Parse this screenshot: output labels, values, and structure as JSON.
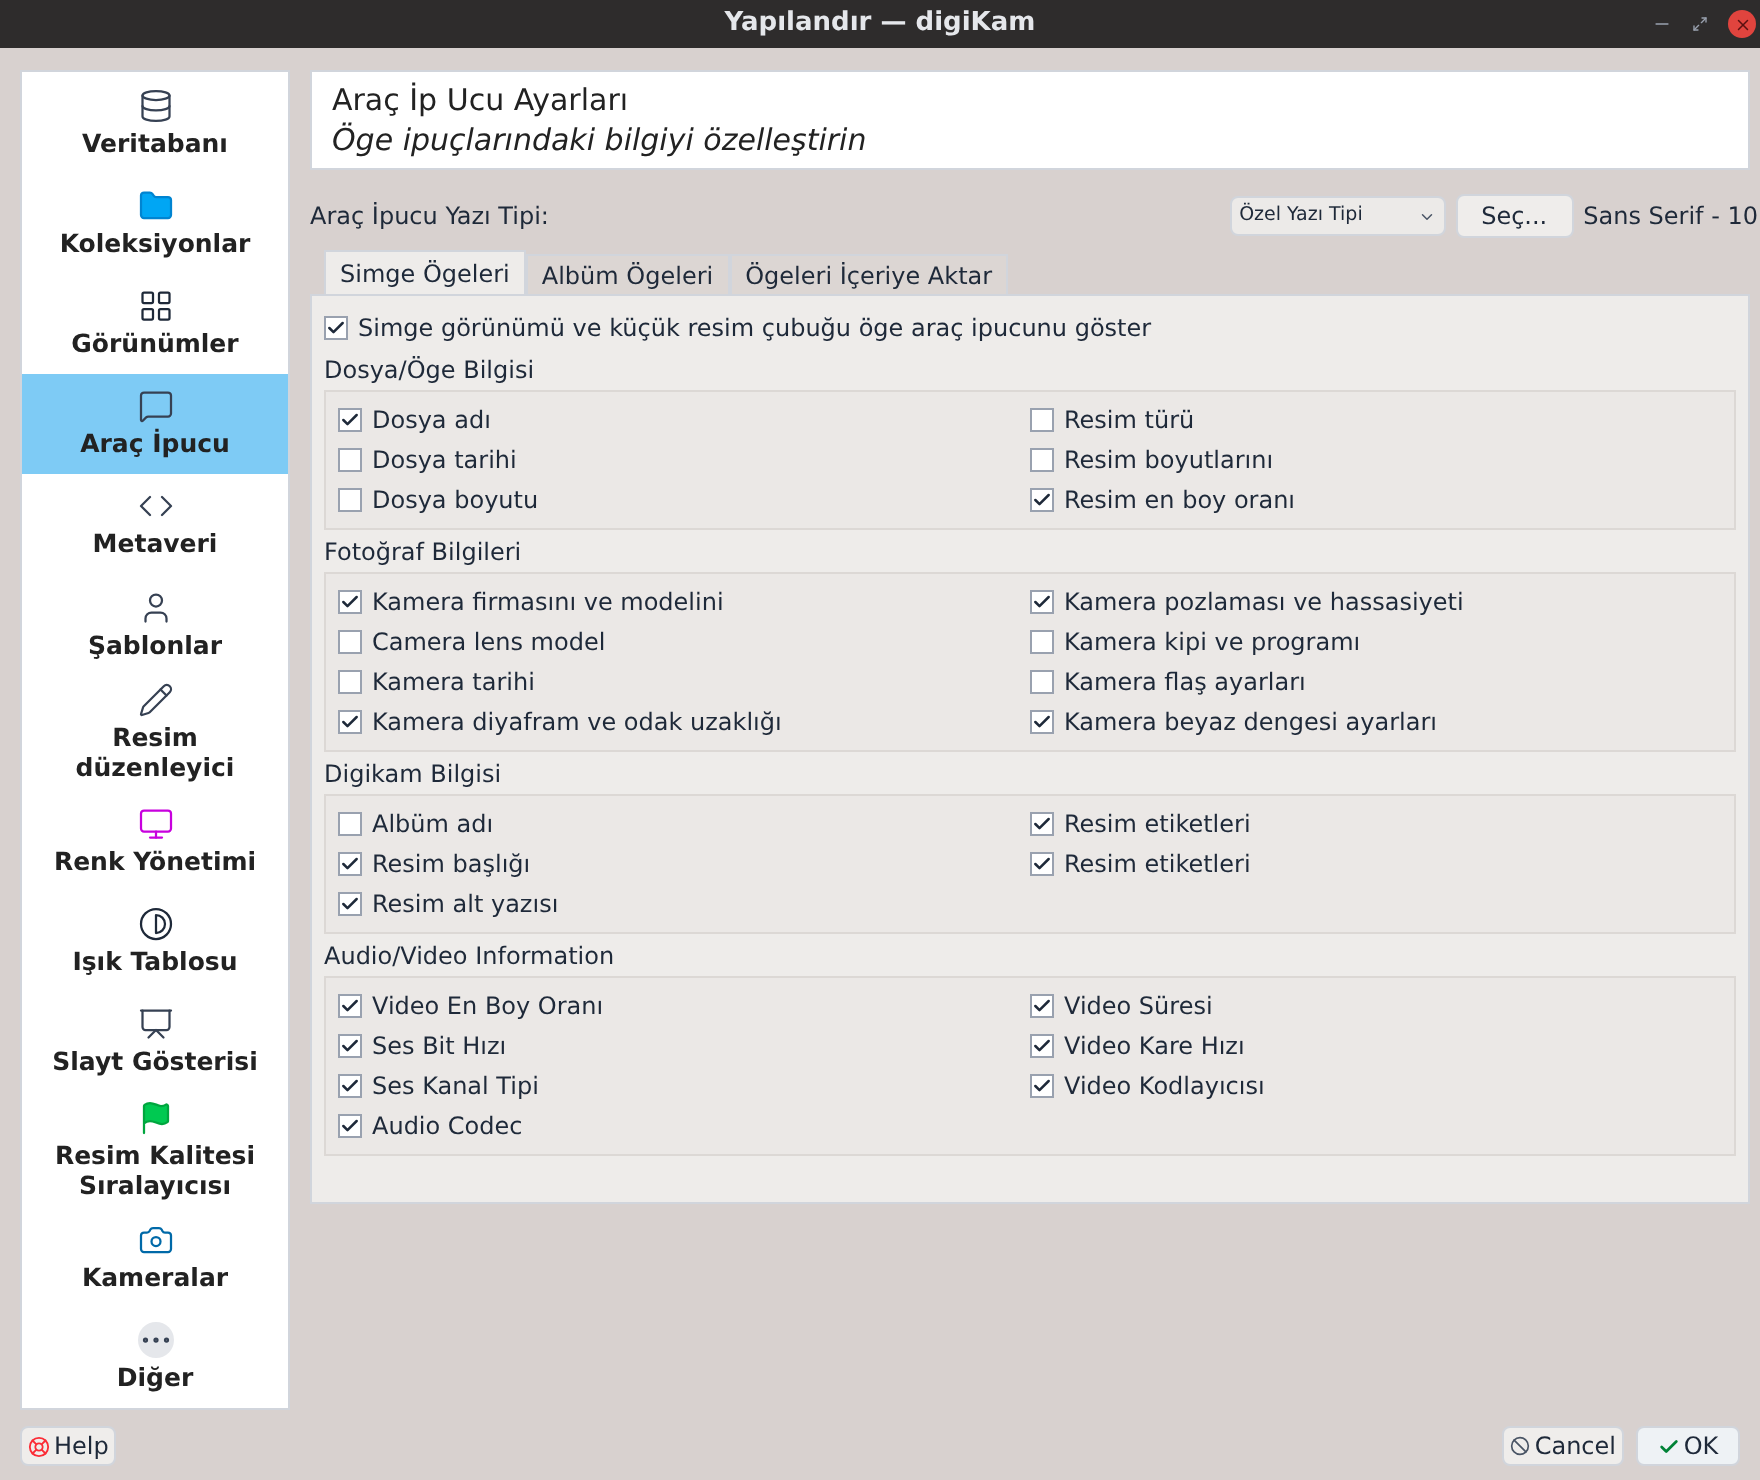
{
  "window": {
    "title": "Yapılandır — digiKam"
  },
  "sidebar": {
    "items": [
      {
        "label": "Veritabanı",
        "selected": false
      },
      {
        "label": "Koleksiyonlar",
        "selected": false
      },
      {
        "label": "Görünümler",
        "selected": false
      },
      {
        "label": "Araç İpucu",
        "selected": true
      },
      {
        "label": "Metaveri",
        "selected": false
      },
      {
        "label": "Şablonlar",
        "selected": false
      },
      {
        "label": "Resim düzenleyici",
        "selected": false
      },
      {
        "label": "Renk Yönetimi",
        "selected": false
      },
      {
        "label": "Işık Tablosu",
        "selected": false
      },
      {
        "label": "Slayt Gösterisi",
        "selected": false
      },
      {
        "label": "Resim Kalitesi Sıralayıcısı",
        "selected": false
      },
      {
        "label": "Kameralar",
        "selected": false
      },
      {
        "label": "Diğer",
        "selected": false
      }
    ]
  },
  "header": {
    "title": "Araç İp Ucu Ayarları",
    "subtitle": "Öge ipuçlarındaki bilgiyi özelleştirin"
  },
  "font_row": {
    "label": "Araç İpucu Yazı Tipi:",
    "dropdown": "Özel Yazı Tipi",
    "button": "Seç...",
    "font": "Sans Serif - 10"
  },
  "tabs": [
    {
      "label": "Simge Ögeleri",
      "selected": true
    },
    {
      "label": "Albüm Ögeleri",
      "selected": false
    },
    {
      "label": "Ögeleri İçeriye Aktar",
      "selected": false
    }
  ],
  "show_tooltip": {
    "label": "Simge görünümü ve küçük resim çubuğu öge araç ipucunu göster",
    "checked": true
  },
  "groups": [
    {
      "title": "Dosya/Öge Bilgisi",
      "columns": [
        [
          {
            "label": "Dosya adı",
            "checked": true
          },
          {
            "label": "Dosya tarihi",
            "checked": false
          },
          {
            "label": "Dosya boyutu",
            "checked": false
          }
        ],
        [
          {
            "label": "Resim türü",
            "checked": false
          },
          {
            "label": "Resim boyutlarını",
            "checked": false
          },
          {
            "label": "Resim en boy oranı",
            "checked": true
          }
        ]
      ]
    },
    {
      "title": "Fotoğraf Bilgileri",
      "columns": [
        [
          {
            "label": "Kamera firmasını ve modelini",
            "checked": true
          },
          {
            "label": "Camera lens model",
            "checked": false
          },
          {
            "label": "Kamera tarihi",
            "checked": false
          },
          {
            "label": "Kamera diyafram ve odak uzaklığı",
            "checked": true
          }
        ],
        [
          {
            "label": "Kamera pozlaması ve hassasiyeti",
            "checked": true
          },
          {
            "label": "Kamera kipi ve programı",
            "checked": false
          },
          {
            "label": "Kamera flaş ayarları",
            "checked": false
          },
          {
            "label": "Kamera beyaz dengesi ayarları",
            "checked": true
          }
        ]
      ]
    },
    {
      "title": "Digikam Bilgisi",
      "columns": [
        [
          {
            "label": "Albüm adı",
            "checked": false
          },
          {
            "label": "Resim başlığı",
            "checked": true
          },
          {
            "label": "Resim alt yazısı",
            "checked": true
          }
        ],
        [
          {
            "label": "Resim etiketleri",
            "checked": true
          },
          {
            "label": "Resim etiketleri",
            "checked": true
          }
        ]
      ]
    },
    {
      "title": "Audio/Video Information",
      "columns": [
        [
          {
            "label": "Video En Boy Oranı",
            "checked": true
          },
          {
            "label": "Ses Bit Hızı",
            "checked": true
          },
          {
            "label": "Ses Kanal Tipi",
            "checked": true
          },
          {
            "label": "Audio Codec",
            "checked": true
          }
        ],
        [
          {
            "label": "Video Süresi",
            "checked": true
          },
          {
            "label": "Video Kare Hızı",
            "checked": true
          },
          {
            "label": "Video Kodlayıcısı",
            "checked": true
          }
        ]
      ]
    }
  ],
  "buttons": {
    "help": "Help",
    "cancel": "Cancel",
    "ok": "OK"
  }
}
